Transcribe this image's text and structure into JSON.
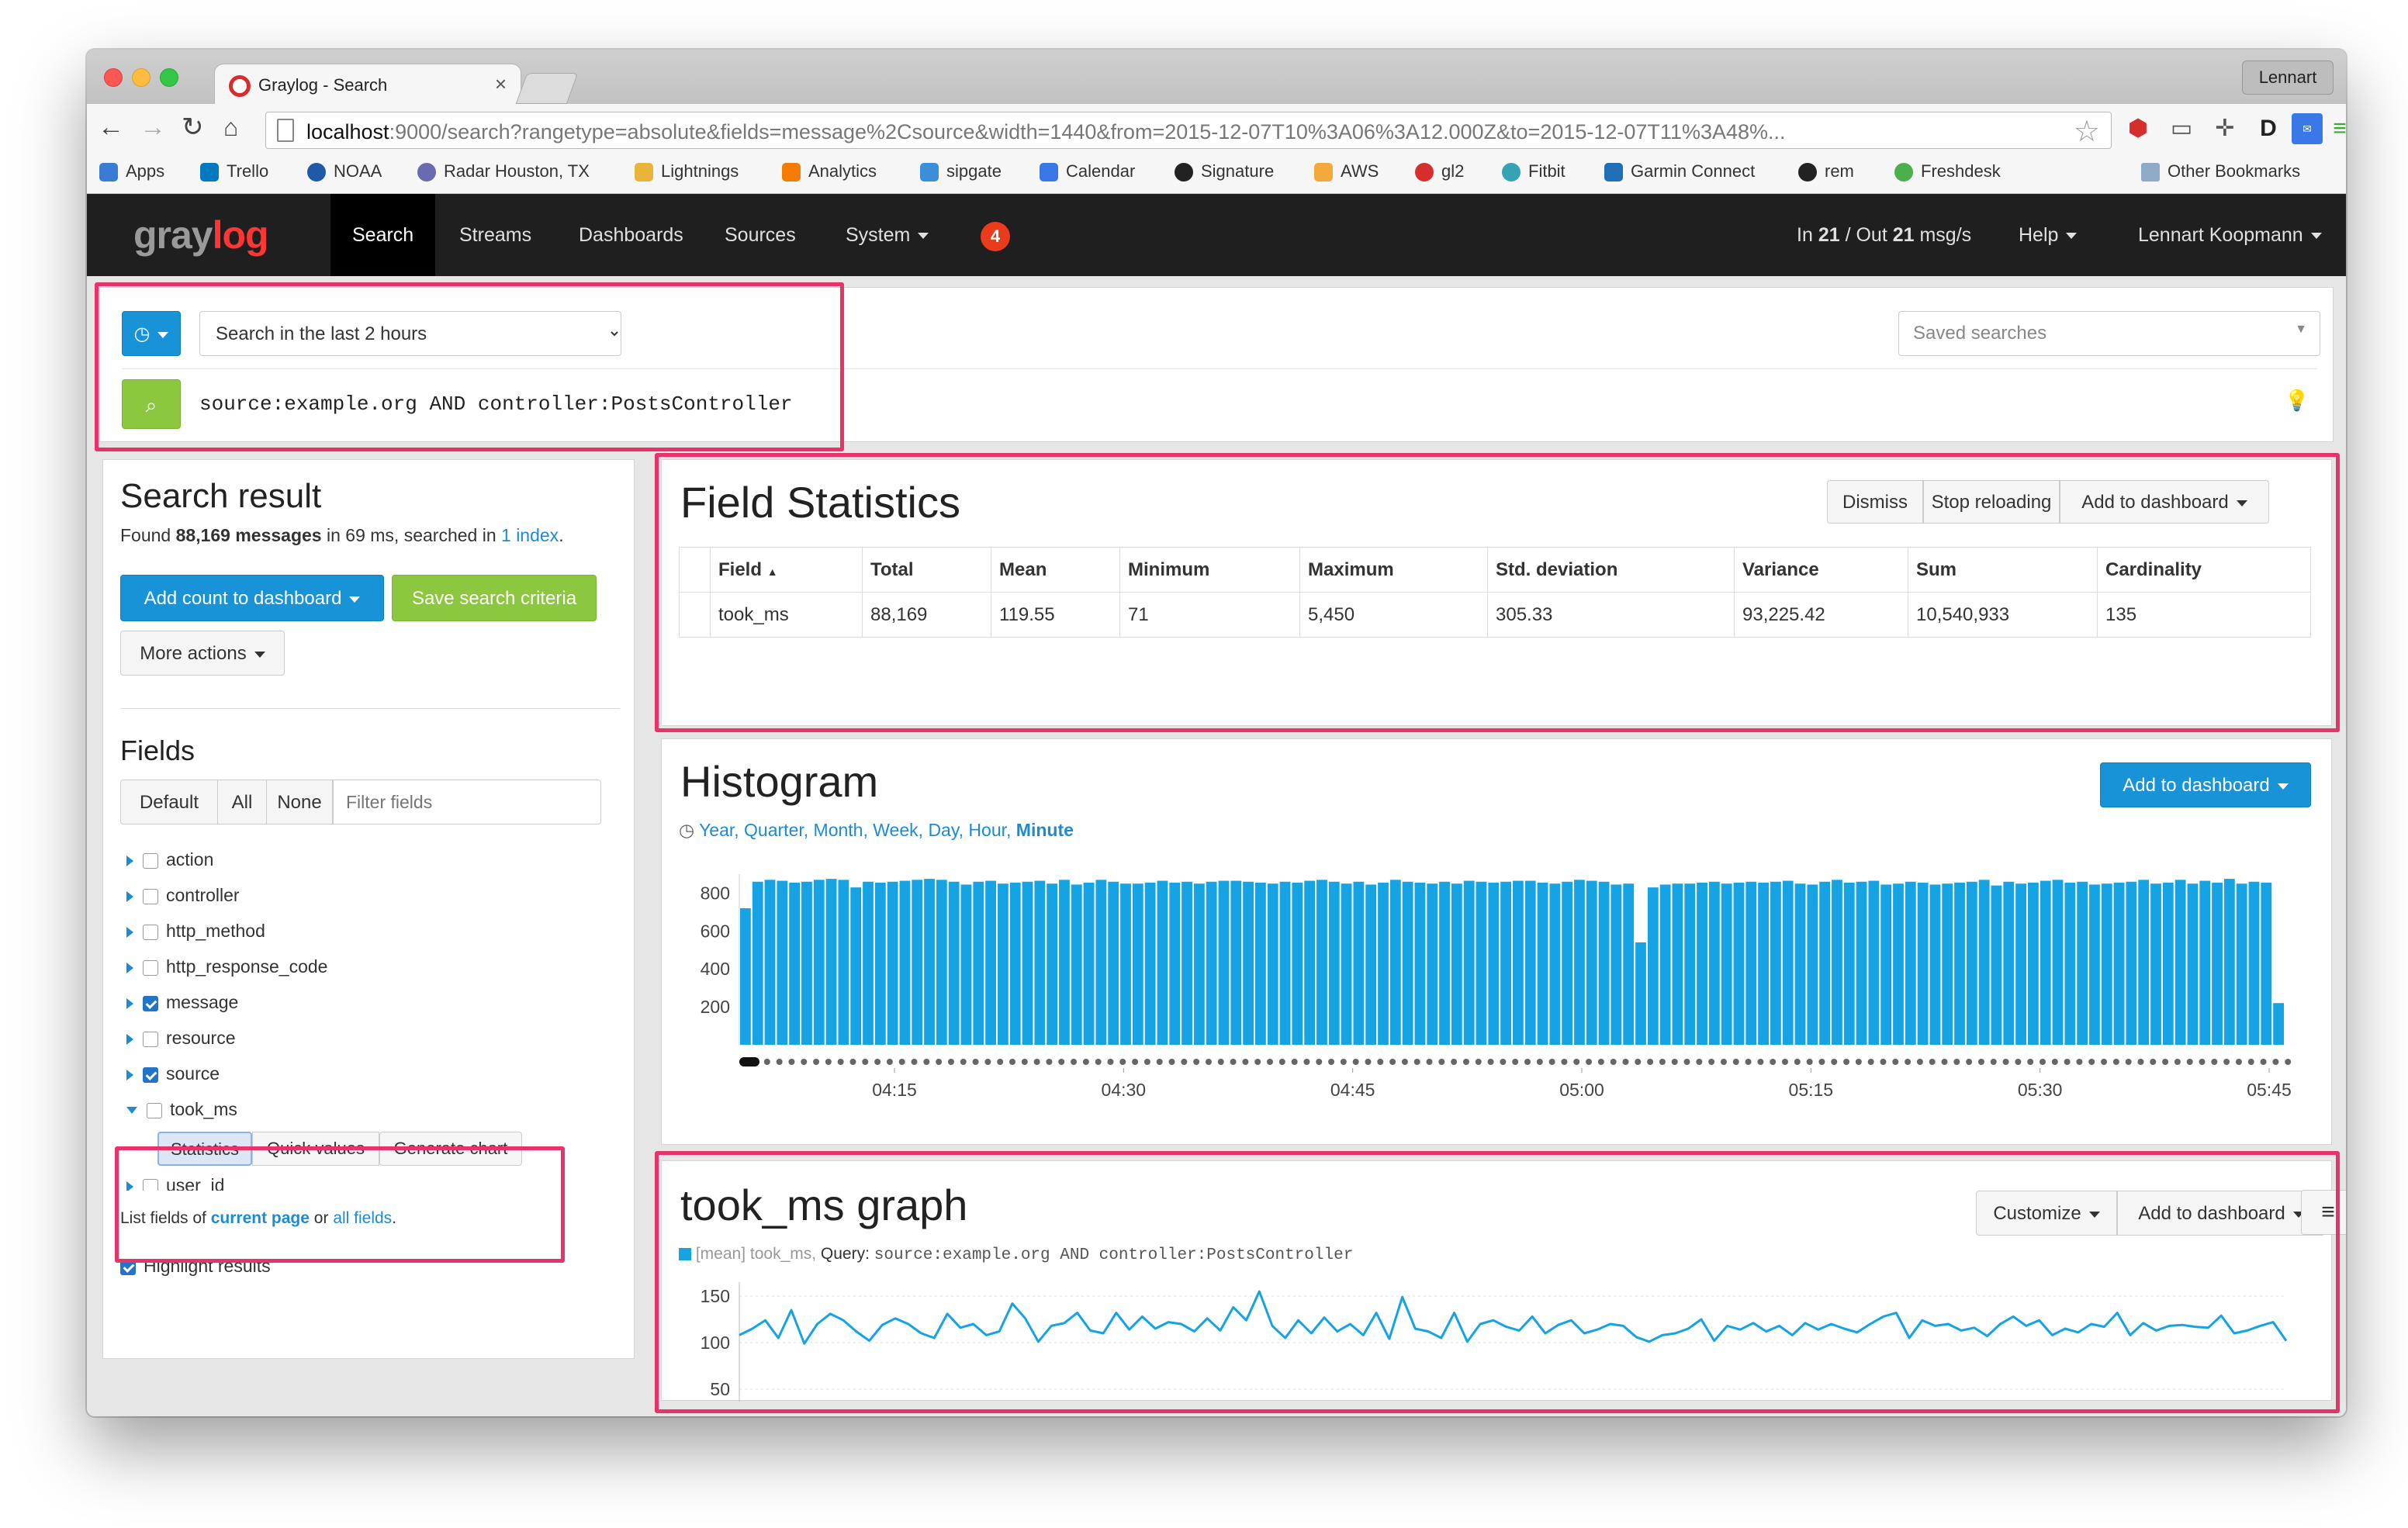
{
  "browser": {
    "tab_title": "Graylog - Search",
    "profile_label": "Lennart",
    "url_host": "localhost",
    "url_rest": ":9000/search?rangetype=absolute&fields=message%2Csource&width=1440&from=2015-12-07T10%3A06%3A12.000Z&to=2015-12-07T11%3A48%...",
    "bookmarks": [
      {
        "label": "Apps",
        "color": "#3a7bd5"
      },
      {
        "label": "Trello",
        "color": "#0079bf"
      },
      {
        "label": "NOAA",
        "color": "#1e5aa8"
      },
      {
        "label": "Radar Houston, TX",
        "color": "#6a6ab0"
      },
      {
        "label": "Lightnings",
        "color": "#e8b53a"
      },
      {
        "label": "Analytics",
        "color": "#f57c00"
      },
      {
        "label": "sipgate",
        "color": "#3b8ed8"
      },
      {
        "label": "Calendar",
        "color": "#3b78e7"
      },
      {
        "label": "Signature",
        "color": "#222222"
      },
      {
        "label": "AWS",
        "color": "#f3a93c"
      },
      {
        "label": "gl2",
        "color": "#d62d2d"
      },
      {
        "label": "Fitbit",
        "color": "#36a3b5"
      },
      {
        "label": "Garmin Connect",
        "color": "#1e6fb5"
      },
      {
        "label": "rem",
        "color": "#222222"
      },
      {
        "label": "Freshdesk",
        "color": "#4bb04b"
      }
    ],
    "other_bookmarks": "Other Bookmarks"
  },
  "nav": {
    "logo_a": "gray",
    "logo_b": "log",
    "items": [
      "Search",
      "Streams",
      "Dashboards",
      "Sources",
      "System"
    ],
    "alert_count": "4",
    "throughput_in_label": "In",
    "throughput_in": "21",
    "throughput_out_label": "/ Out",
    "throughput_out": "21",
    "throughput_unit": "msg/s",
    "help": "Help",
    "user": "Lennart Koopmann"
  },
  "search": {
    "range": "Search in the last 2 hours",
    "query": "source:example.org AND controller:PostsController",
    "saved_placeholder": "Saved searches"
  },
  "result": {
    "title": "Search result",
    "found_label": "Found",
    "count": "88,169 messages",
    "time_text": "in 69 ms, searched in",
    "index_link": "1 index",
    "period": ".",
    "add_count": "Add count to dashboard",
    "save_search": "Save search criteria",
    "more_actions": "More actions"
  },
  "fields": {
    "title": "Fields",
    "buttons": [
      "Default",
      "All",
      "None"
    ],
    "filter_placeholder": "Filter fields",
    "list": [
      {
        "name": "action",
        "checked": false
      },
      {
        "name": "controller",
        "checked": false
      },
      {
        "name": "http_method",
        "checked": false
      },
      {
        "name": "http_response_code",
        "checked": false
      },
      {
        "name": "message",
        "checked": true
      },
      {
        "name": "resource",
        "checked": false
      },
      {
        "name": "source",
        "checked": true
      },
      {
        "name": "took_ms",
        "checked": false
      },
      {
        "name": "user_id",
        "checked": false
      }
    ],
    "actions": [
      "Statistics",
      "Quick values",
      "Generate chart"
    ],
    "list_text": "List fields of",
    "current_page": "current page",
    "or": "or",
    "all_fields": "all fields",
    "highlight": "Highlight results"
  },
  "field_stats": {
    "title": "Field Statistics",
    "buttons": [
      "Dismiss",
      "Stop reloading",
      "Add to dashboard"
    ],
    "headers": [
      "Field",
      "Total",
      "Mean",
      "Minimum",
      "Maximum",
      "Std. deviation",
      "Variance",
      "Sum",
      "Cardinality"
    ],
    "row": [
      "took_ms",
      "88,169",
      "119.55",
      "71",
      "5,450",
      "305.33",
      "93,225.42",
      "10,540,933",
      "135"
    ]
  },
  "histogram": {
    "title": "Histogram",
    "add_to_dashboard": "Add to dashboard",
    "resolutions": [
      "Year,",
      "Quarter,",
      "Month,",
      "Week,",
      "Day,",
      "Hour,",
      "Minute"
    ],
    "active_resolution": "Minute"
  },
  "graph": {
    "title": "took_ms graph",
    "customize": "Customize",
    "add_to_dashboard": "Add to dashboard",
    "legend_series": "[mean] took_ms,",
    "legend_query_label": "Query:",
    "legend_query": "source:example.org AND controller:PostsController"
  },
  "chart_data": [
    {
      "type": "bar",
      "x_labels": [
        "04:15",
        "04:30",
        "04:45",
        "05:00",
        "05:15",
        "05:30",
        "05:45"
      ],
      "y_ticks": [
        200,
        400,
        600,
        800
      ],
      "ylim": [
        0,
        900
      ],
      "values": [
        720,
        860,
        870,
        865,
        855,
        860,
        870,
        875,
        870,
        830,
        860,
        855,
        860,
        865,
        870,
        875,
        870,
        860,
        845,
        860,
        865,
        850,
        855,
        860,
        865,
        850,
        870,
        845,
        855,
        870,
        860,
        850,
        850,
        855,
        865,
        855,
        860,
        850,
        860,
        865,
        865,
        860,
        855,
        850,
        860,
        855,
        865,
        870,
        860,
        850,
        860,
        845,
        855,
        870,
        860,
        855,
        850,
        860,
        850,
        865,
        860,
        855,
        860,
        865,
        865,
        855,
        850,
        860,
        870,
        865,
        860,
        845,
        850,
        540,
        830,
        845,
        850,
        850,
        855,
        860,
        850,
        855,
        860,
        855,
        860,
        865,
        850,
        845,
        860,
        870,
        855,
        860,
        865,
        845,
        850,
        860,
        855,
        845,
        850,
        855,
        860,
        870,
        840,
        860,
        850,
        855,
        865,
        870,
        855,
        860,
        845,
        850,
        855,
        860,
        870,
        850,
        855,
        870,
        850,
        865,
        855,
        875,
        850,
        860,
        855,
        220
      ],
      "grid": false,
      "color": "#15a3e3"
    },
    {
      "type": "line",
      "series": [
        {
          "name": "[mean] took_ms",
          "color": "#15a3e3"
        }
      ],
      "y_ticks": [
        50,
        100,
        150
      ],
      "ylim": [
        45,
        160
      ],
      "values": [
        108,
        115,
        124,
        105,
        135,
        99,
        120,
        131,
        124,
        112,
        102,
        119,
        126,
        120,
        110,
        105,
        131,
        116,
        120,
        108,
        112,
        142,
        126,
        101,
        118,
        121,
        132,
        113,
        110,
        132,
        114,
        128,
        115,
        122,
        120,
        112,
        126,
        113,
        138,
        124,
        155,
        118,
        105,
        124,
        110,
        127,
        112,
        120,
        108,
        132,
        104,
        149,
        115,
        112,
        105,
        132,
        101,
        120,
        124,
        117,
        113,
        128,
        110,
        119,
        124,
        110,
        114,
        120,
        118,
        106,
        101,
        108,
        110,
        115,
        125,
        102,
        118,
        114,
        121,
        112,
        118,
        108,
        121,
        114,
        120,
        115,
        111,
        120,
        128,
        132,
        105,
        124,
        118,
        120,
        113,
        116,
        107,
        120,
        128,
        118,
        124,
        108,
        115,
        111,
        120,
        117,
        132,
        108,
        121,
        113,
        118,
        119,
        117,
        116,
        129,
        110,
        113,
        118,
        122,
        102
      ],
      "grid": true
    }
  ]
}
